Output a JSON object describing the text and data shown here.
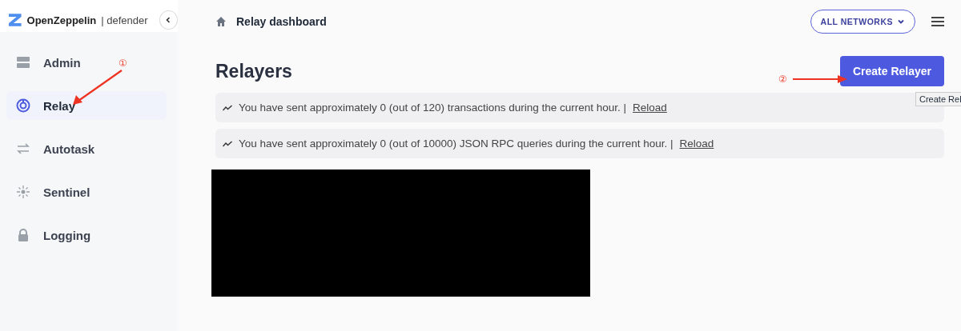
{
  "brand": {
    "name": "OpenZeppelin",
    "product": "| defender"
  },
  "sidebar": {
    "items": [
      {
        "label": "Admin",
        "selected": false
      },
      {
        "label": "Relay",
        "selected": true
      },
      {
        "label": "Autotask",
        "selected": false
      },
      {
        "label": "Sentinel",
        "selected": false
      },
      {
        "label": "Logging",
        "selected": false
      }
    ]
  },
  "breadcrumb": "Relay dashboard",
  "network_button": "ALL NETWORKS",
  "page_title": "Relayers",
  "create_button": "Create Relayer",
  "tooltip": "Create Rel",
  "notices": [
    {
      "text": "You have sent approximately 0 (out of 120) transactions during the current hour. |",
      "link": "Reload"
    },
    {
      "text": "You have sent approximately 0 (out of 10000) JSON RPC queries during the current hour. |",
      "link": "Reload"
    }
  ],
  "annotations": [
    "①",
    "②"
  ]
}
